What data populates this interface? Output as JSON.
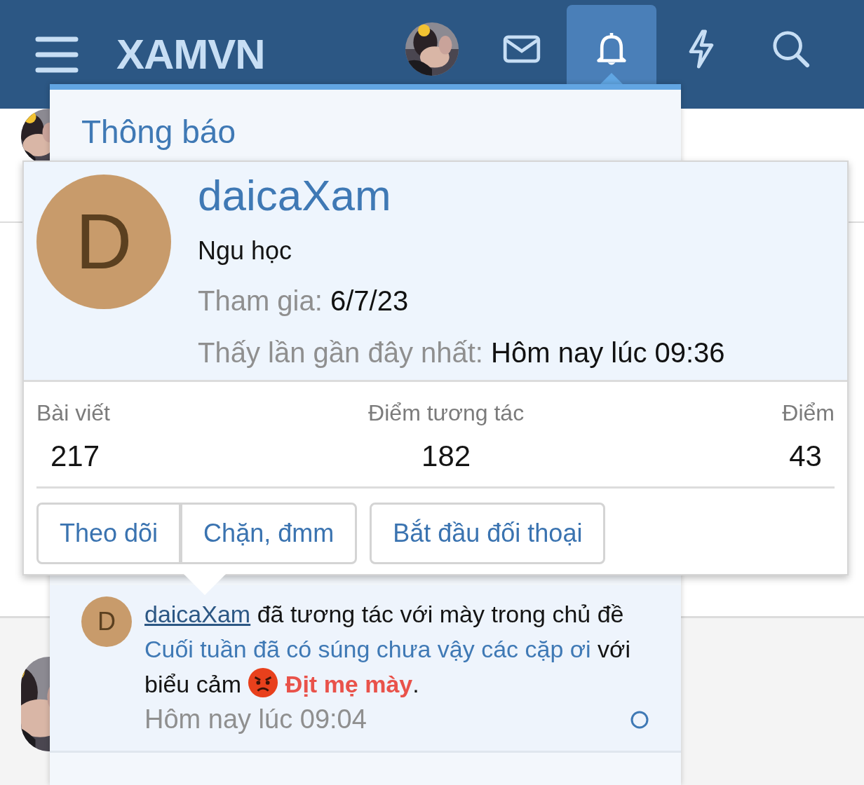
{
  "header": {
    "logo": "XAMVN",
    "nav": [
      {
        "kind": "avatar",
        "selected": false
      },
      {
        "kind": "mail",
        "selected": false
      },
      {
        "kind": "bell",
        "selected": true
      },
      {
        "kind": "bolt",
        "selected": false
      },
      {
        "kind": "search",
        "selected": false
      }
    ]
  },
  "notifications": {
    "title": "Thông báo",
    "items": [
      {
        "avatar_letter": "D",
        "user": "daicaXam",
        "text_1": "đã tương tác với mày trong chủ đề",
        "thread": "Cuối tuần đã có súng chưa vậy các cặp ơi",
        "text_2": "với biểu cảm",
        "reaction": "Địt mẹ mày",
        "end": ".",
        "time": "Hôm nay lúc 09:04",
        "unread": true
      }
    ]
  },
  "profile_card": {
    "avatar_letter": "D",
    "username": "daicaXam",
    "user_title": "Ngu học",
    "facts": [
      {
        "label": "Tham gia:",
        "value": "6/7/23"
      },
      {
        "label": "Thấy lần gần đây nhất:",
        "value": "Hôm nay lúc 09:36"
      }
    ],
    "stats": [
      {
        "label": "Bài viết",
        "value": "217"
      },
      {
        "label": "Điểm tương tác",
        "value": "182"
      },
      {
        "label": "Điểm",
        "value": "43"
      }
    ],
    "button_groups": [
      [
        "Theo dõi",
        "Chặn, đmm"
      ],
      [
        "Bắt đầu đối thoại"
      ]
    ]
  }
}
